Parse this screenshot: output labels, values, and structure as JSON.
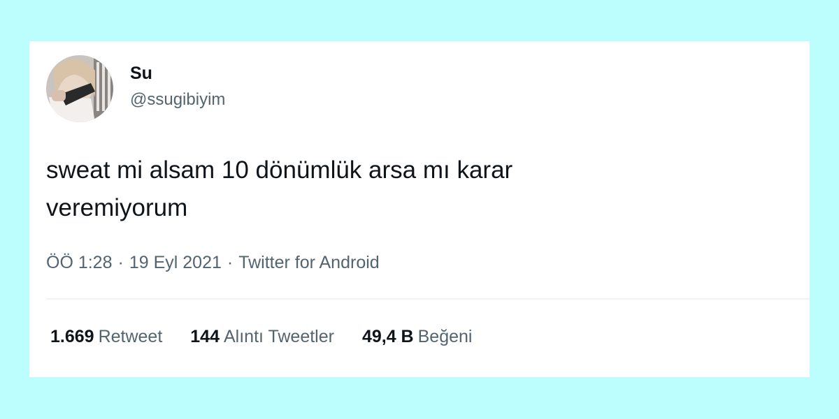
{
  "tweet": {
    "author": {
      "display_name": "Su",
      "handle": "@ssugibiyim"
    },
    "text": "sweat mi alsam 10 dönümlük arsa mı karar\nveremiyorum",
    "meta": {
      "time": "ÖÖ 1:28",
      "separator": "·",
      "date": "19 Eyl 2021",
      "source": "Twitter for Android"
    },
    "stats": {
      "retweets": {
        "count": "1.669",
        "label": "Retweet"
      },
      "quotes": {
        "count": "144",
        "label": "Alıntı Tweetler"
      },
      "likes": {
        "count": "49,4 B",
        "label": "Beğeni"
      }
    }
  },
  "colors": {
    "page_background": "#bcfdfd",
    "card_background": "#ffffff",
    "primary_text": "#0f1419",
    "secondary_text": "#536471"
  },
  "icons": {
    "avatar": "profile-photo"
  }
}
